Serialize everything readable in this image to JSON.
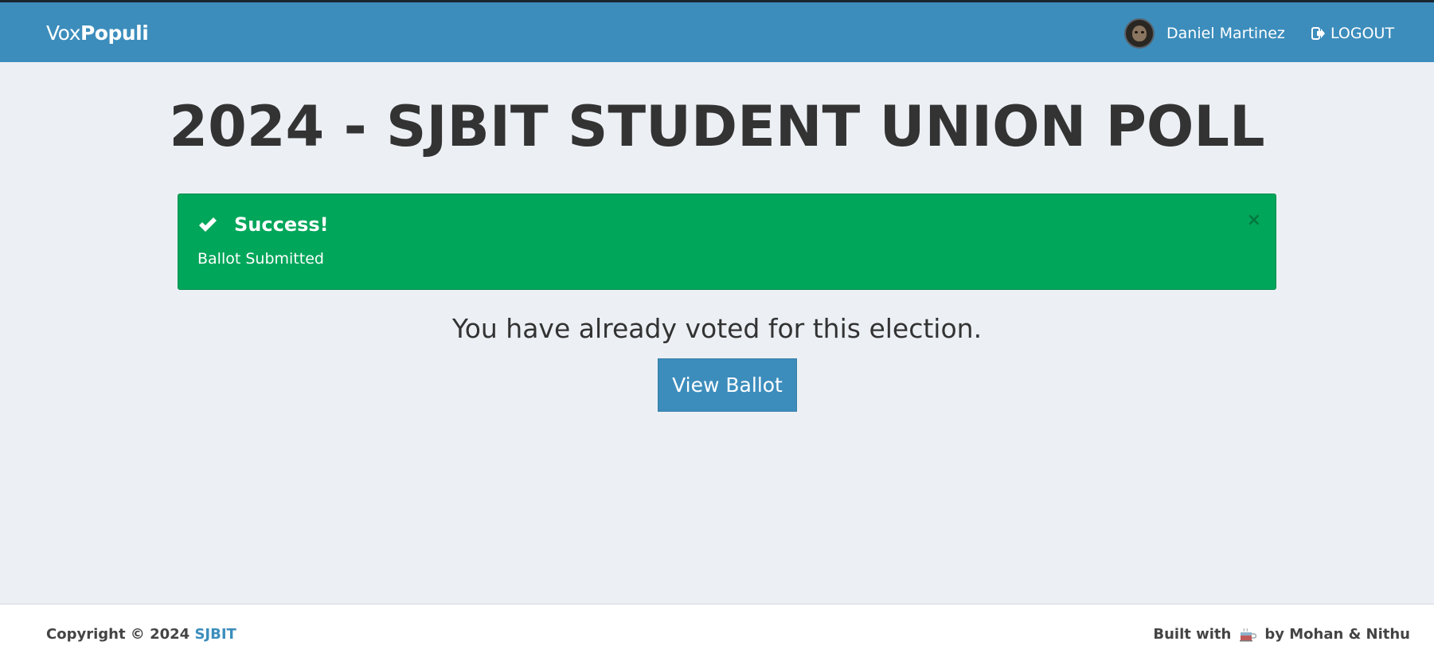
{
  "navbar": {
    "brand_light": "Vox",
    "brand_bold": "Populi",
    "user_name": "Daniel Martinez",
    "logout_label": "LOGOUT"
  },
  "page": {
    "title": "2024 - SJBIT STUDENT UNION POLL"
  },
  "alert": {
    "title": "Success!",
    "message": "Ballot Submitted",
    "close": "×"
  },
  "content": {
    "voted_message": "You have already voted for this election.",
    "view_ballot_label": "View Ballot"
  },
  "footer": {
    "copyright_prefix": "Copyright © 2024",
    "copyright_link": "SJBIT",
    "built_with": "Built with",
    "built_by": "by Mohan & Nithu"
  },
  "colors": {
    "primary": "#3c8dbc",
    "success": "#00a65a",
    "background": "#ecf0f5"
  }
}
